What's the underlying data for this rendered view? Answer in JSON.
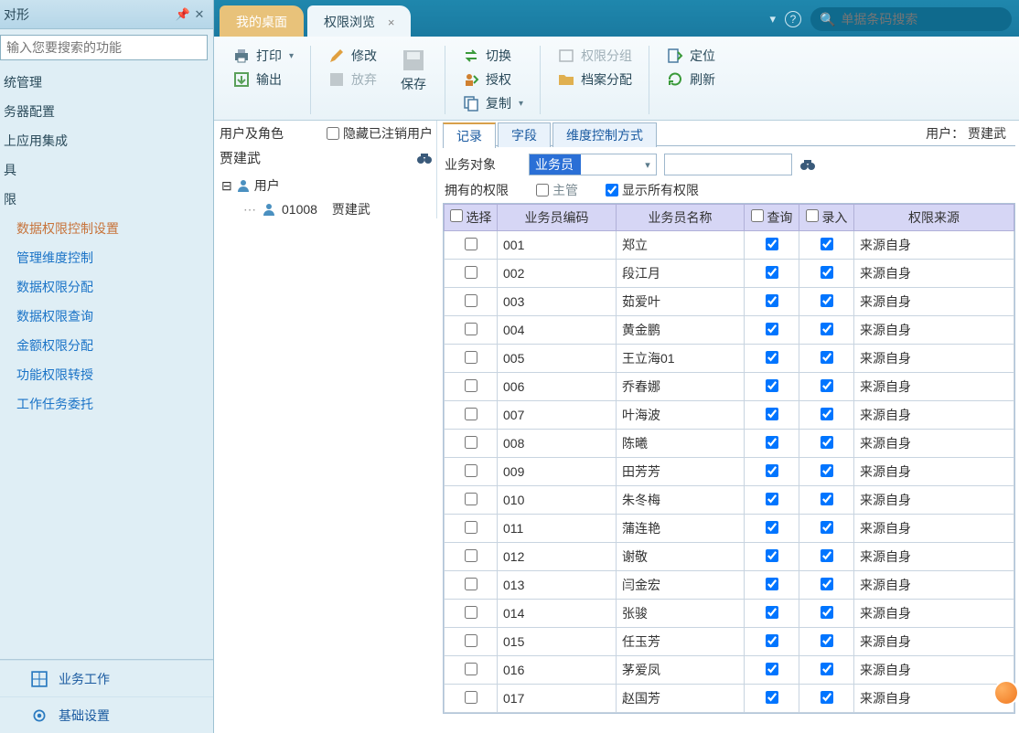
{
  "sidebar": {
    "title": "对形",
    "search_placeholder": "输入您要搜索的功能",
    "nav": [
      "统管理",
      "务器配置",
      "上应用集成",
      "具",
      "限"
    ],
    "sub_nav": [
      "数据权限控制设置",
      "管理维度控制",
      "数据权限分配",
      "数据权限查询",
      "金额权限分配",
      "功能权限转授",
      "工作任务委托"
    ],
    "footer": [
      "业务工作",
      "基础设置"
    ]
  },
  "tabs": {
    "desktop": "我的桌面",
    "browse": "权限浏览"
  },
  "barcode_placeholder": "单据条码搜索",
  "toolbar": {
    "print": "打印",
    "export": "输出",
    "modify": "修改",
    "discard": "放弃",
    "save": "保存",
    "switch": "切换",
    "authorize": "授权",
    "copy": "复制",
    "perm_group": "权限分组",
    "file_assign": "档案分配",
    "locate": "定位",
    "refresh": "刷新"
  },
  "left_tree": {
    "label": "用户及角色",
    "hide_closed": "隐藏已注销用户",
    "user_name": "贾建武",
    "node_user": "用户",
    "node_child_code": "01008",
    "node_child_name": "贾建武"
  },
  "sub_tabs": {
    "record": "记录",
    "field": "字段",
    "dim": "维度控制方式"
  },
  "header_user_label": "用户：",
  "header_user_value": "贾建武",
  "form": {
    "biz_obj_label": "业务对象",
    "biz_obj_value": "业务员",
    "owned_label": "拥有的权限",
    "mgr_label": "主管",
    "show_all_label": "显示所有权限",
    "show_all_checked": true
  },
  "columns": {
    "select": "选择",
    "code": "业务员编码",
    "name": "业务员名称",
    "query": "查询",
    "entry": "录入",
    "source": "权限来源"
  },
  "rows": [
    {
      "code": "001",
      "name": "郑立",
      "q": true,
      "e": true,
      "src": "来源自身"
    },
    {
      "code": "002",
      "name": "段江月",
      "q": true,
      "e": true,
      "src": "来源自身"
    },
    {
      "code": "003",
      "name": "茹爱叶",
      "q": true,
      "e": true,
      "src": "来源自身"
    },
    {
      "code": "004",
      "name": "黄金鹏",
      "q": true,
      "e": true,
      "src": "来源自身"
    },
    {
      "code": "005",
      "name": "王立海01",
      "q": true,
      "e": true,
      "src": "来源自身"
    },
    {
      "code": "006",
      "name": "乔春娜",
      "q": true,
      "e": true,
      "src": "来源自身"
    },
    {
      "code": "007",
      "name": "叶海波",
      "q": true,
      "e": true,
      "src": "来源自身"
    },
    {
      "code": "008",
      "name": "陈曦",
      "q": true,
      "e": true,
      "src": "来源自身"
    },
    {
      "code": "009",
      "name": "田芳芳",
      "q": true,
      "e": true,
      "src": "来源自身"
    },
    {
      "code": "010",
      "name": "朱冬梅",
      "q": true,
      "e": true,
      "src": "来源自身"
    },
    {
      "code": "011",
      "name": "蒲连艳",
      "q": true,
      "e": true,
      "src": "来源自身"
    },
    {
      "code": "012",
      "name": "谢敬",
      "q": true,
      "e": true,
      "src": "来源自身"
    },
    {
      "code": "013",
      "name": "闫金宏",
      "q": true,
      "e": true,
      "src": "来源自身"
    },
    {
      "code": "014",
      "name": "张骏",
      "q": true,
      "e": true,
      "src": "来源自身"
    },
    {
      "code": "015",
      "name": "任玉芳",
      "q": true,
      "e": true,
      "src": "来源自身"
    },
    {
      "code": "016",
      "name": "茅爱凤",
      "q": true,
      "e": true,
      "src": "来源自身"
    },
    {
      "code": "017",
      "name": "赵国芳",
      "q": true,
      "e": true,
      "src": "来源自身"
    }
  ]
}
